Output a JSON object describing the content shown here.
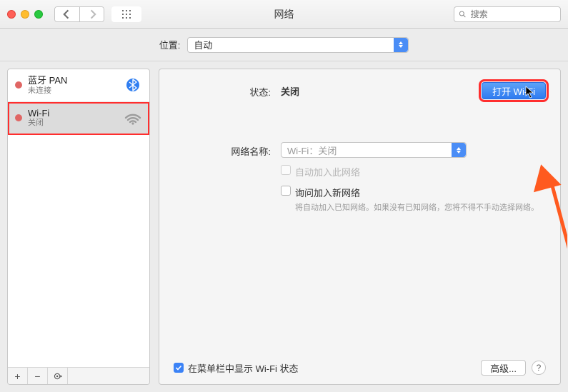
{
  "window": {
    "title": "网络",
    "search_placeholder": "搜索"
  },
  "location": {
    "label": "位置:",
    "value": "自动"
  },
  "sidebar": {
    "items": [
      {
        "name": "蓝牙 PAN",
        "status": "未连接"
      },
      {
        "name": "Wi-Fi",
        "status": "关闭"
      }
    ],
    "footer": {
      "add": "+",
      "remove": "−"
    }
  },
  "content": {
    "status_label": "状态:",
    "status_value": "关闭",
    "turn_on_button": "打开 Wi-Fi",
    "network_name_label": "网络名称:",
    "network_name_value": "Wi-Fi：关闭",
    "auto_join_label": "自动加入此网络",
    "ask_join_label": "询问加入新网络",
    "ask_join_help": "将自动加入已知网络。如果没有已知网络，您将不得不手动选择网络。",
    "show_in_menu": "在菜单栏中显示 Wi-Fi 状态",
    "advanced_button": "高级...",
    "help": "?"
  }
}
